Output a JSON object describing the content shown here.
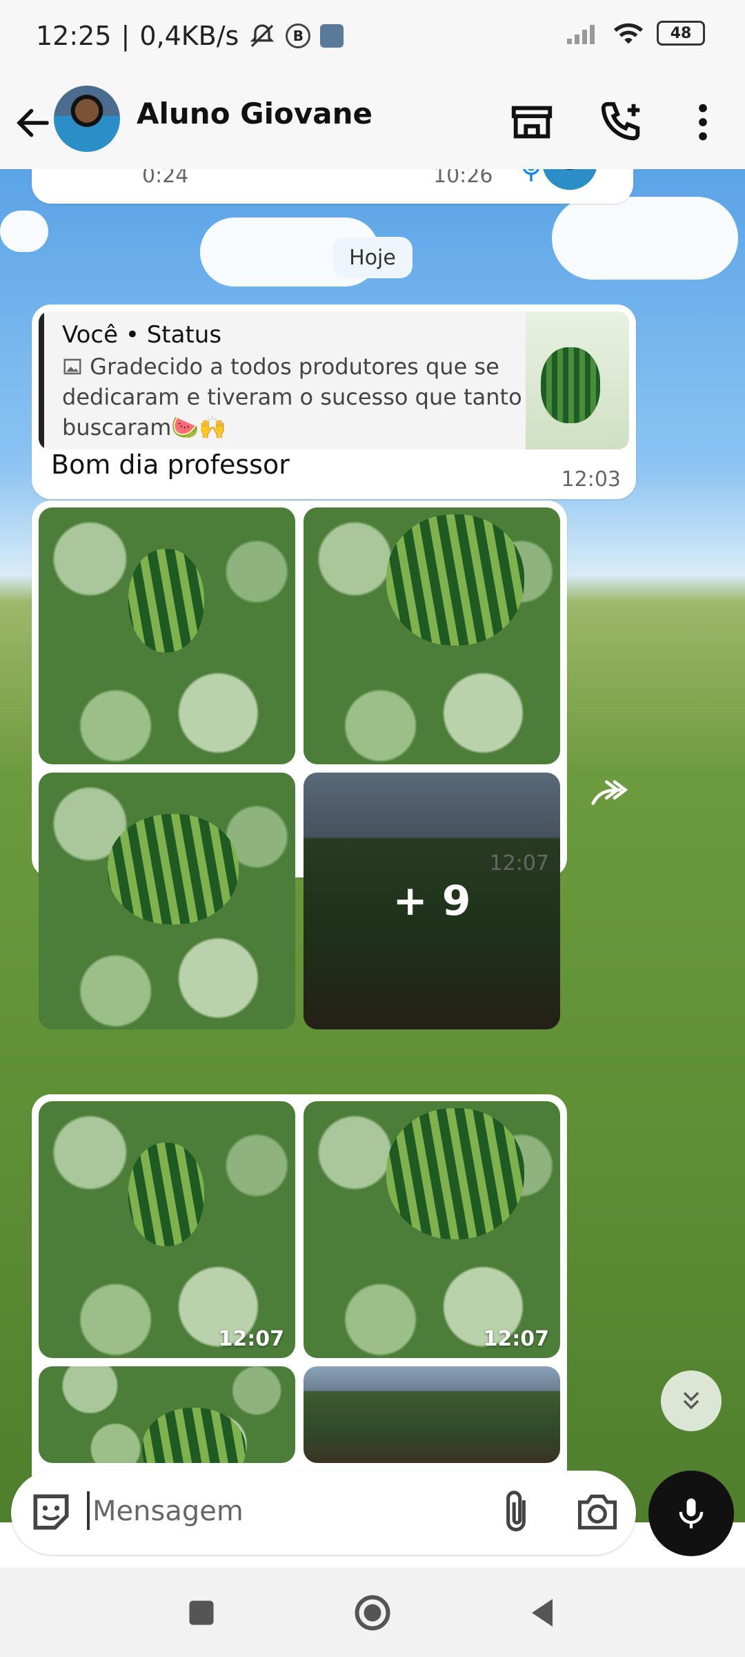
{
  "status_bar": {
    "time": "12:25",
    "separator": "|",
    "network_speed": "0,4KB/s",
    "indicator_b": "B",
    "battery": "48"
  },
  "header": {
    "contact_name": "Aluno Giovane"
  },
  "chat": {
    "previous_bubble": {
      "duration": "0:24",
      "time": "10:26"
    },
    "date_chip": "Hoje",
    "quoted_message": {
      "author_line": "Você • Status",
      "quote_text": "Gradecido a todos produtores que se dedicaram e tiveram o sucesso que tanto buscaram🍉🙌",
      "message": "Bom dia professor",
      "time": "12:03"
    },
    "album_1": {
      "more_count": "+ 9",
      "time": "12:07"
    },
    "album_2": {
      "tile_times": [
        "12:07",
        "12:07"
      ]
    }
  },
  "composer": {
    "placeholder": "Mensagem"
  },
  "theme": {
    "accent": "#111111",
    "bubble": "#ffffff",
    "voice_blue": "#1e88e5"
  }
}
